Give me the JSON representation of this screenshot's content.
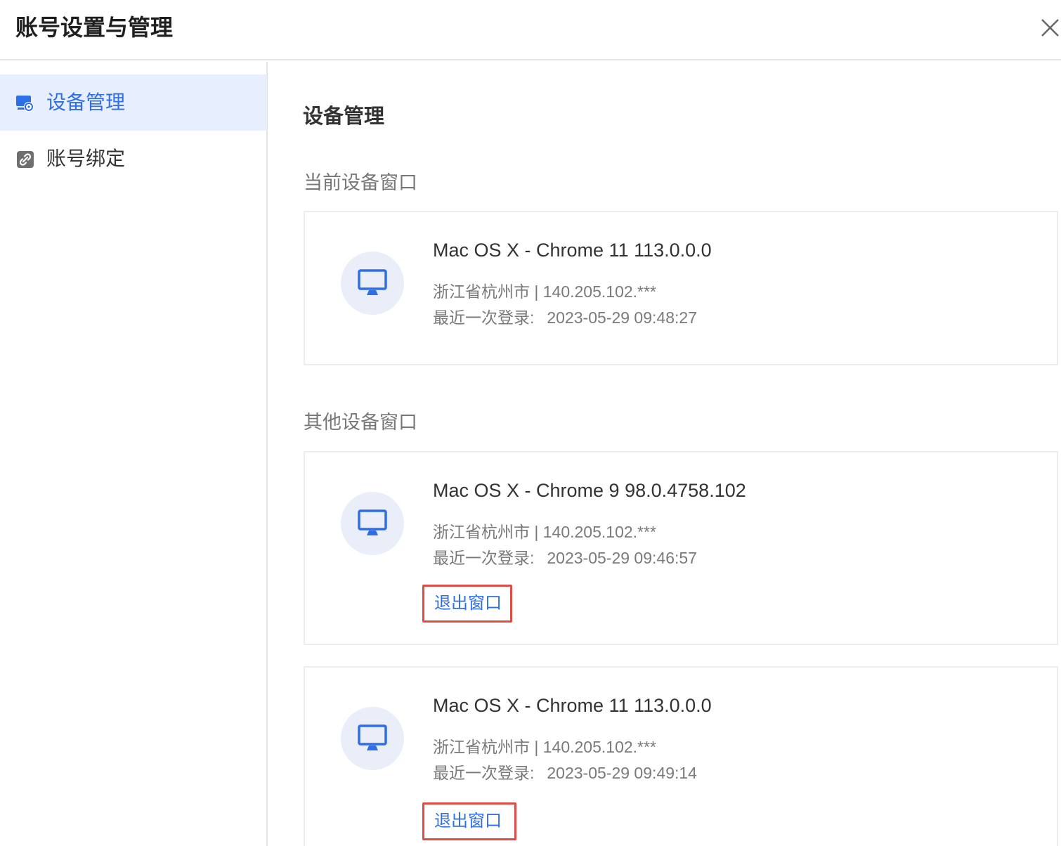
{
  "dialog": {
    "title": "账号设置与管理",
    "close_icon": "close-icon"
  },
  "sidebar": {
    "items": [
      {
        "label": "设备管理",
        "icon": "device-settings-icon",
        "active": true
      },
      {
        "label": "账号绑定",
        "icon": "link-icon",
        "active": false
      }
    ]
  },
  "main": {
    "title": "设备管理",
    "current_section_label": "当前设备窗口",
    "other_section_label": "其他设备窗口",
    "last_login_label": "最近一次登录:",
    "current_device": {
      "name": "Mac OS X - Chrome 11 113.0.0.0",
      "location": "浙江省杭州市 | 140.205.102.***",
      "last_login": "2023-05-29 09:48:27"
    },
    "other_devices": [
      {
        "name": "Mac OS X - Chrome 9 98.0.4758.102",
        "location": "浙江省杭州市 | 140.205.102.***",
        "last_login": "2023-05-29 09:46:57",
        "logout_label": "退出窗口"
      },
      {
        "name": "Mac OS X - Chrome 11 113.0.0.0",
        "location": "浙江省杭州市 | 140.205.102.***",
        "last_login": "2023-05-29 09:49:14",
        "logout_label": "退出窗口"
      }
    ]
  },
  "colors": {
    "accent": "#2e6ee6",
    "active_bg": "#e7eefd",
    "highlight_border": "#e14b45",
    "avatar_bg": "#e9eef9"
  }
}
